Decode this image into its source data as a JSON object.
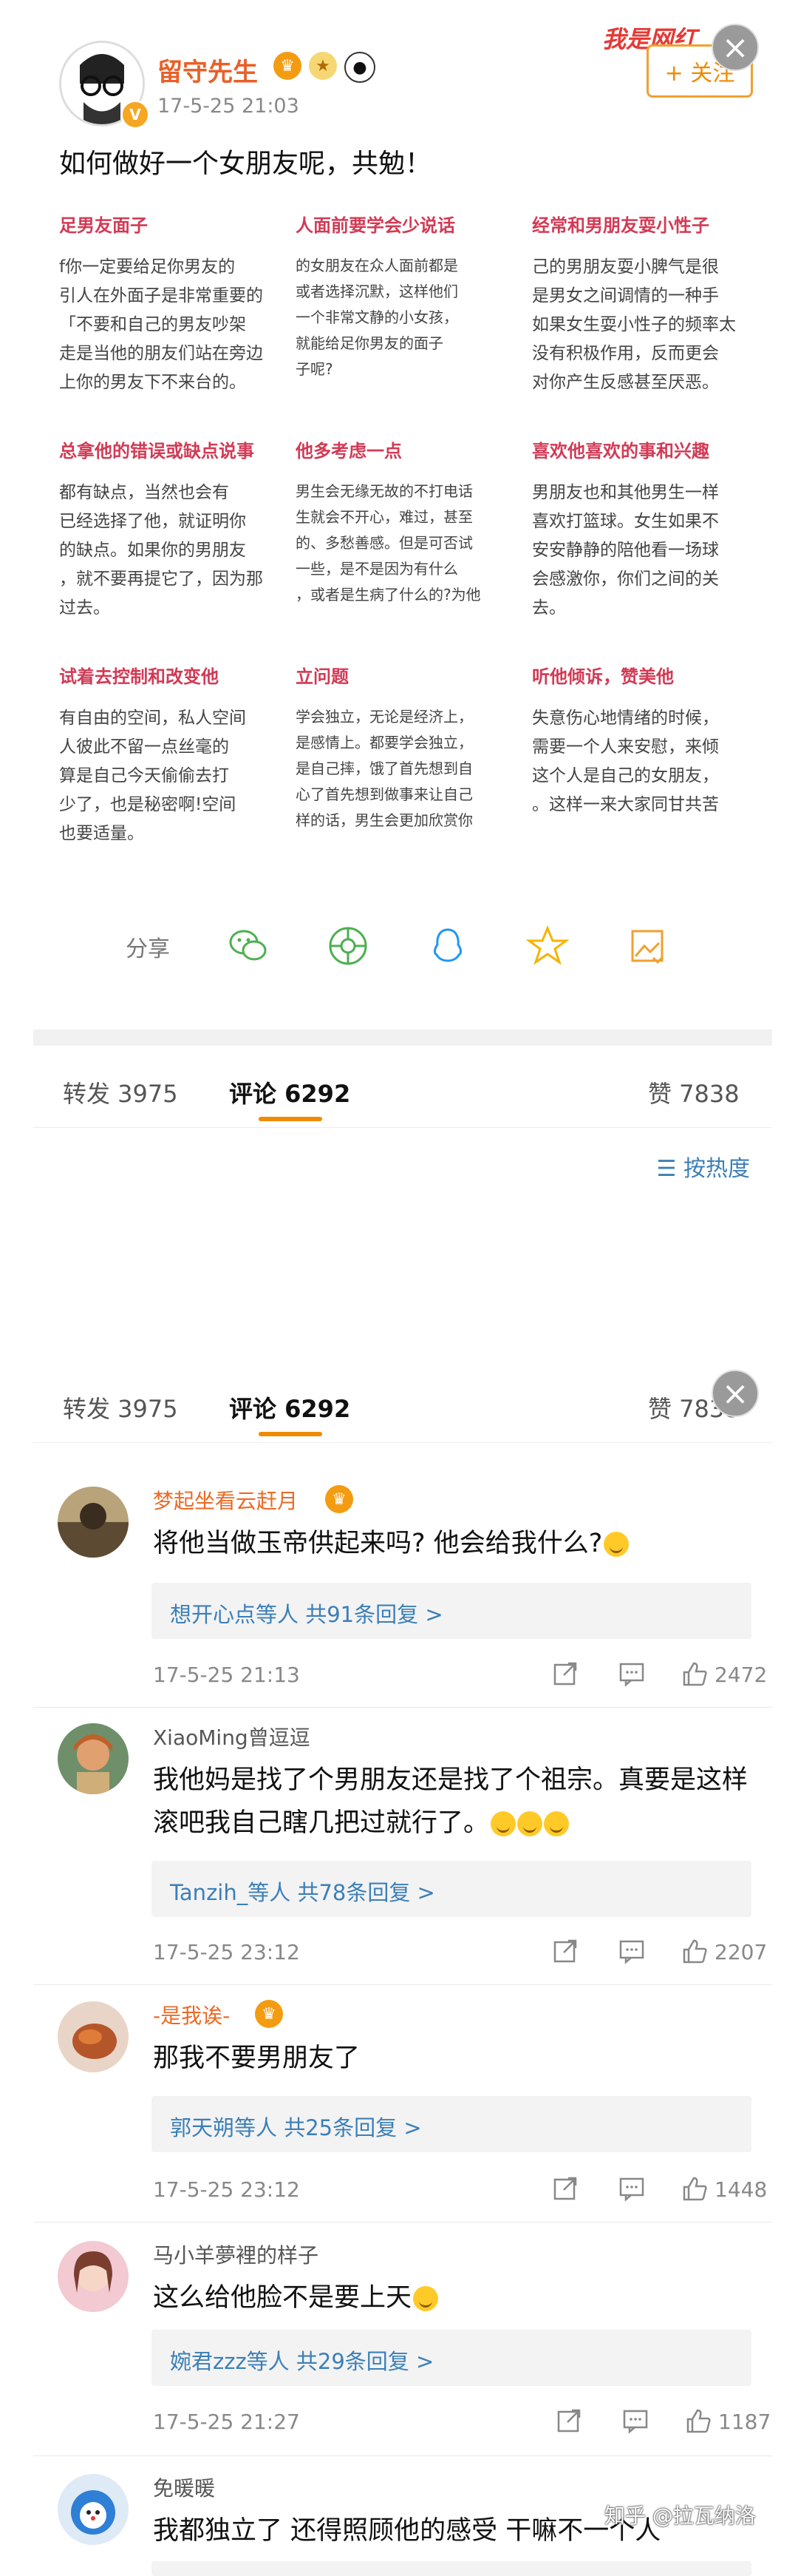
{
  "post": {
    "username": "留守先生",
    "time": "17-5-25 21:03",
    "watermark": "我是网红",
    "follow_label": "+ 关注",
    "text": "如何做好一个女朋友呢，共勉！",
    "verified_badge": "V",
    "badges": [
      "crown-badge-icon",
      "medal-badge-icon",
      "panda-badge-icon"
    ],
    "tips": [
      {
        "title": "足男友面子",
        "body": "f你一定要给足你男友的\n引人在外面子是非常重要的\n「不要和自己的男友吵架\n走是当他的朋友们站在旁边\n上你的男友下不来台的。"
      },
      {
        "title": "人面前要学会少说话",
        "body": "的女朋友在众人面前都是\n或者选择沉默，这样他们\n一个非常文静的小女孩，\n就能给足你男友的面子\n子呢?"
      },
      {
        "title": "经常和男朋友耍小性子",
        "body": "己的男朋友耍小脾气是很\n是男女之间调情的一种手\n如果女生耍小性子的频率太\n没有积极作用，反而更会\n对你产生反感甚至厌恶。"
      },
      {
        "title": "总拿他的错误或缺点说事",
        "body": "都有缺点，当然也会有\n已经选择了他，就证明你\n的缺点。如果你的男朋友\n，就不要再提它了，因为那\n过去。"
      },
      {
        "title": "他多考虑一点",
        "body": "男生会无缘无故的不打电话\n生就会不开心，难过，甚至\n的、多愁善感。但是可否试\n一些，是不是因为有什么\n，或者是生病了什么的?为他"
      },
      {
        "title": "喜欢他喜欢的事和兴趣",
        "body": "男朋友也和其他男生一样\n喜欢打篮球。女生如果不\n安安静静的陪他看一场球\n会感激你，你们之间的关\n去。"
      },
      {
        "title": "试着去控制和改变他",
        "body": "有自由的空间，私人空间\n人彼此不留一点丝毫的\n算是自己今天偷偷去打\n少了，也是秘密啊!空间\n也要适量。"
      },
      {
        "title": "立问题",
        "body": "学会独立，无论是经济上，\n是感情上。都要学会独立，\n是自己摔，饿了首先想到自\n心了首先想到做事来让自己\n样的话，男生会更加欣赏你"
      },
      {
        "title": "听他倾诉，赞美他",
        "body": "失意伤心地情绪的时候，\n需要一个人来安慰，来倾\n这个人是自己的女朋友，\n。这样一来大家同甘共苦"
      }
    ],
    "share_label": "分享",
    "share_icons": [
      "wechat-icon",
      "moments-icon",
      "qq-icon",
      "qzone-icon",
      "save-image-icon"
    ]
  },
  "tabs": {
    "repost": "转发 3975",
    "comment": "评论 6292",
    "like": "赞 7838"
  },
  "sort_label": "按热度",
  "comments": [
    {
      "name": "梦起坐看云赶月",
      "text": "将他当做玉帝供起来吗? 他会给我什么?",
      "replies": "想开心点等人  共91条回复 >",
      "time": "17-5-25 21:13",
      "likes": "2472"
    },
    {
      "name": "XiaoMing曾逗逗",
      "text": "我他妈是找了个男朋友还是找了个祖宗。真要是这样滚吧我自己瞎几把过就行了。",
      "replies": "Tanzih_等人  共78条回复 >",
      "time": "17-5-25 23:12",
      "likes": "2207"
    },
    {
      "name": "-是我诶-",
      "text": "那我不要男朋友了",
      "replies": "郭天朔等人  共25条回复 >",
      "time": "17-5-25 23:12",
      "likes": "1448"
    },
    {
      "name": "马小羊夢裡的样子",
      "text": "这么给他脸不是要上天",
      "replies": "婉君zzz等人  共29条回复 >",
      "time": "17-5-25 21:27",
      "likes": "1187"
    },
    {
      "name": "免暖暖",
      "text": "我都独立了 还得照顾他的感受 干嘛不一个人",
      "replies": "",
      "time": "",
      "likes": ""
    }
  ],
  "zhihu_watermark": "知乎 @拉瓦纳洛",
  "colors": {
    "accent": "#f08a00",
    "name_orange": "#ea6a25",
    "link_blue": "#3b7fb8",
    "tip_title_red": "#d23a55"
  }
}
